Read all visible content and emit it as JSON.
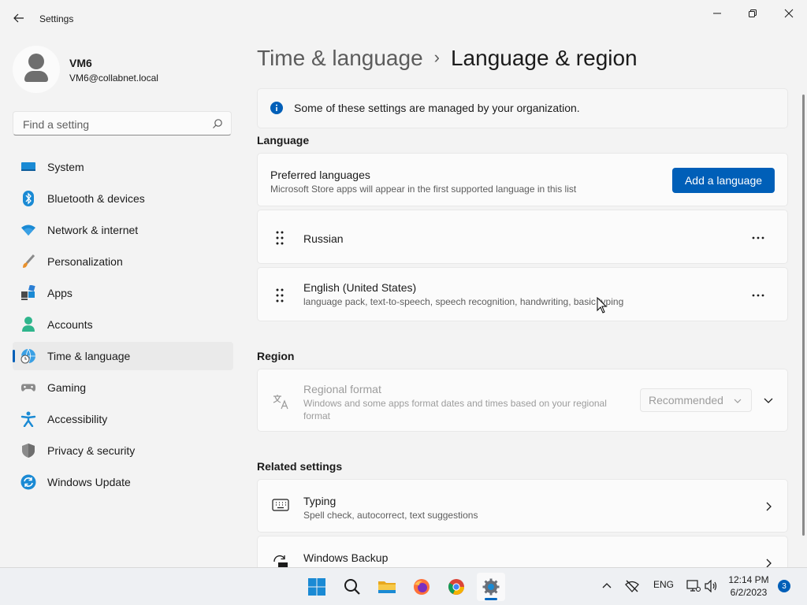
{
  "app": {
    "title": "Settings"
  },
  "profile": {
    "name": "VM6",
    "email": "VM6@collabnet.local"
  },
  "search": {
    "placeholder": "Find a setting"
  },
  "sidebar": {
    "items": [
      {
        "label": "System",
        "icon": "monitor-icon"
      },
      {
        "label": "Bluetooth & devices",
        "icon": "bluetooth-icon"
      },
      {
        "label": "Network & internet",
        "icon": "wifi-icon"
      },
      {
        "label": "Personalization",
        "icon": "brush-icon"
      },
      {
        "label": "Apps",
        "icon": "apps-icon"
      },
      {
        "label": "Accounts",
        "icon": "person-icon"
      },
      {
        "label": "Time & language",
        "icon": "globe-clock-icon",
        "active": true
      },
      {
        "label": "Gaming",
        "icon": "gamepad-icon"
      },
      {
        "label": "Accessibility",
        "icon": "accessibility-icon"
      },
      {
        "label": "Privacy & security",
        "icon": "shield-icon"
      },
      {
        "label": "Windows Update",
        "icon": "update-icon"
      }
    ]
  },
  "breadcrumb": {
    "parent": "Time & language",
    "separator": "›",
    "current": "Language & region"
  },
  "info_banner": {
    "text": "Some of these settings are managed by your organization."
  },
  "language": {
    "heading": "Language",
    "preferred": {
      "title": "Preferred languages",
      "subtitle": "Microsoft Store apps will appear in the first supported language in this list",
      "button": "Add a language"
    },
    "languages": [
      {
        "name": "Russian",
        "features": ""
      },
      {
        "name": "English (United States)",
        "features": "language pack, text-to-speech, speech recognition, handwriting, basic typing"
      }
    ]
  },
  "region": {
    "heading": "Region",
    "format": {
      "title": "Regional format",
      "subtitle": "Windows and some apps format dates and times based on your regional format",
      "value": "Recommended"
    }
  },
  "related": {
    "heading": "Related settings",
    "items": [
      {
        "title": "Typing",
        "subtitle": "Spell check, autocorrect, text suggestions"
      },
      {
        "title": "Windows Backup",
        "subtitle": ""
      }
    ]
  },
  "taskbar": {
    "tray": {
      "lang": "ENG",
      "time": "12:14 PM",
      "date": "6/2/2023",
      "notifications": "3"
    }
  },
  "colors": {
    "accent": "#005fb8",
    "background": "#f3f3f3",
    "card": "#fbfbfb"
  }
}
